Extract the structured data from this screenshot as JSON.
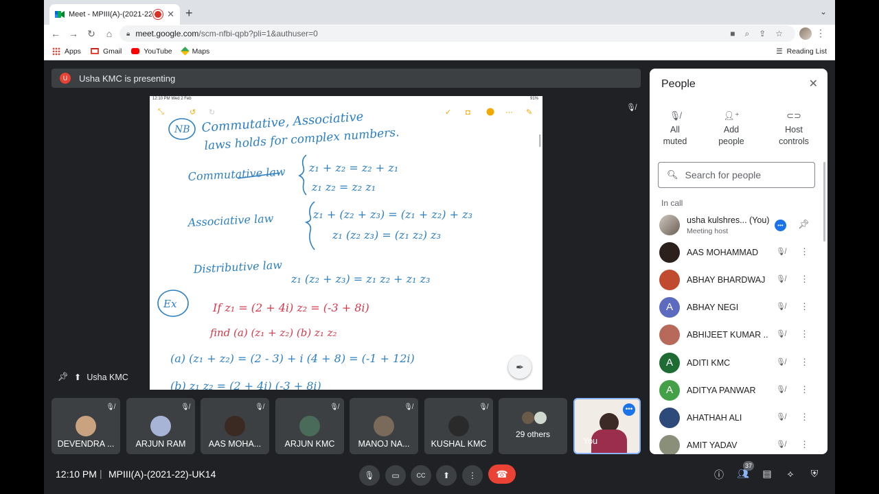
{
  "browser": {
    "tab_title": "Meet - MPIII(A)-(2021-22)",
    "url_host": "meet.google.com",
    "url_path": "/scm-nfbi-qpb?pli=1&authuser=0",
    "bookmarks": [
      "Apps",
      "Gmail",
      "YouTube",
      "Maps"
    ],
    "reading_list": "Reading List"
  },
  "meet": {
    "presenting_banner": "Usha KMC is presenting",
    "presenter_initial": "U",
    "presenter_label": "Usha KMC",
    "time": "12:10 PM",
    "separator": "|",
    "meeting_code": "MPIII(A)-(2021-22)-UK14",
    "people_count": "37"
  },
  "slide": {
    "ipad_time": "12:10 PM  Wed 2 Feb",
    "ipad_battery": "91%",
    "nb": "NB",
    "line1": "Commutative, Associative",
    "line2": "laws holds for complex numbers.",
    "commutative_law": "Commutative law",
    "comm_eq1": "z₁ + z₂ = z₂ + z₁",
    "comm_eq2": "z₁ z₂ = z₂ z₁",
    "associative_law": "Associative law",
    "assoc_eq1": "z₁ + (z₂ + z₃) = (z₁ + z₂) + z₃",
    "assoc_eq2": "z₁ (z₂ z₃) = (z₁ z₂) z₃",
    "distributive_law": "Distributive law",
    "dist_eq": "z₁ (z₂ + z₃) = z₁ z₂ + z₁ z₃",
    "ex": "Ex",
    "if_line": "If   z₁ = (2 + 4i)      z₂ = (-3 + 8i)",
    "find_line": "find (a) (z₁ + z₂)      (b) z₁ z₂",
    "sol_a": "(a)  (z₁ + z₂) = (2 - 3) + i (4 + 8)  = (-1 + 12i)",
    "sol_b": "(b)  z₁ z₂ = (2 + 4i) (-3 + 8i)"
  },
  "tiles": [
    {
      "name": "DEVENDRA ...",
      "color": "#c9a27f"
    },
    {
      "name": "ARJUN RAM",
      "color": "#a7b4d6"
    },
    {
      "name": "AAS MOHA...",
      "color": "#3a2a22"
    },
    {
      "name": "ARJUN KMC",
      "color": "#4a6b5a"
    },
    {
      "name": "MANOJ NA...",
      "color": "#7a6a5a"
    },
    {
      "name": "KUSHAL KMC",
      "color": "#2a2a2a"
    }
  ],
  "others_tile": "29 others",
  "you_tile": "You",
  "people_panel": {
    "title": "People",
    "actions": [
      {
        "label1": "All",
        "label2": "muted",
        "icon": "mic-off-icon"
      },
      {
        "label1": "Add",
        "label2": "people",
        "icon": "add-person-icon"
      },
      {
        "label1": "Host",
        "label2": "controls",
        "icon": "toggle-icon"
      }
    ],
    "search_placeholder": "Search for people",
    "in_call": "In call",
    "host": {
      "name": "usha kulshres... (You)",
      "role": "Meeting host"
    },
    "people": [
      {
        "name": "AAS MOHAMMAD",
        "initial": "",
        "color": "#2b201b"
      },
      {
        "name": "ABHAY BHARDWAJ",
        "initial": "",
        "color": "#c04b2f"
      },
      {
        "name": "ABHAY NEGI",
        "initial": "A",
        "color": "#5c6bc0"
      },
      {
        "name": "ABHIJEET KUMAR ...",
        "initial": "",
        "color": "#b76a5a"
      },
      {
        "name": "ADITI KMC",
        "initial": "A",
        "color": "#1e6b33"
      },
      {
        "name": "ADITYA PANWAR",
        "initial": "A",
        "color": "#43a047"
      },
      {
        "name": "AHATHAH ALI",
        "initial": "",
        "color": "#2e4a7a"
      },
      {
        "name": "AMIT YADAV",
        "initial": "",
        "color": "#8a8f7a"
      }
    ]
  },
  "colors": {
    "meet_bg": "#202124",
    "hangup": "#ea4335",
    "ink_blue": "#2d7fc1",
    "ink_red": "#d6384a",
    "accent": "#1a73e8"
  }
}
